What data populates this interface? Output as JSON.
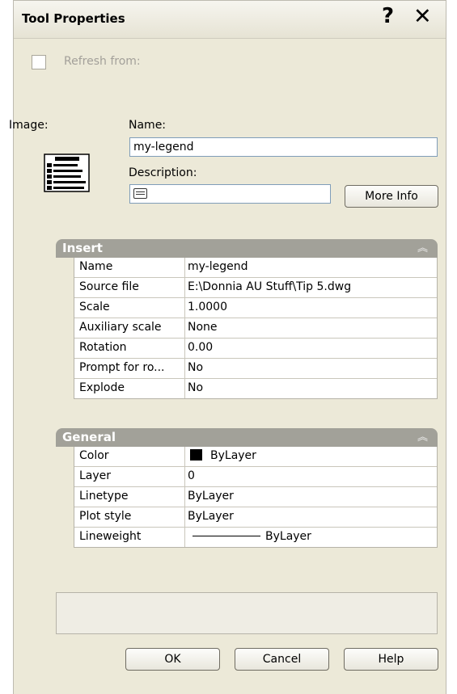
{
  "dialog": {
    "title": "Tool Properties",
    "help_glyph": "?",
    "close_glyph": "✕"
  },
  "refresh": {
    "label": "Refresh from:",
    "checked": false
  },
  "image_label": "Image:",
  "name_field": {
    "label": "Name:",
    "value": "my-legend"
  },
  "description_field": {
    "label": "Description:",
    "value": ""
  },
  "more_info_label": "More Info",
  "insert_section": {
    "title": "Insert",
    "collapse_icon": "double-chevron-up-icon",
    "rows": [
      {
        "name": "Name",
        "value": "my-legend"
      },
      {
        "name": "Source file",
        "value": "E:\\Donnia AU Stuff\\Tip 5.dwg"
      },
      {
        "name": "Scale",
        "value": "1.0000"
      },
      {
        "name": "Auxiliary scale",
        "value": "None"
      },
      {
        "name": "Rotation",
        "value": "0.00"
      },
      {
        "name": "Prompt for ro...",
        "value": "No"
      },
      {
        "name": "Explode",
        "value": "No"
      }
    ]
  },
  "general_section": {
    "title": "General",
    "collapse_icon": "double-chevron-up-icon",
    "rows": [
      {
        "name": "Color",
        "value": "ByLayer",
        "swatch": "#000000"
      },
      {
        "name": "Layer",
        "value": "0"
      },
      {
        "name": "Linetype",
        "value": "ByLayer"
      },
      {
        "name": "Plot style",
        "value": "ByLayer"
      },
      {
        "name": "Lineweight",
        "value": "ByLayer"
      }
    ]
  },
  "buttons": {
    "ok": "OK",
    "cancel": "Cancel",
    "help": "Help"
  },
  "colors": {
    "dialog_bg": "#ece9d8",
    "section_header": "#a2a199",
    "input_border": "#7f9db9"
  }
}
